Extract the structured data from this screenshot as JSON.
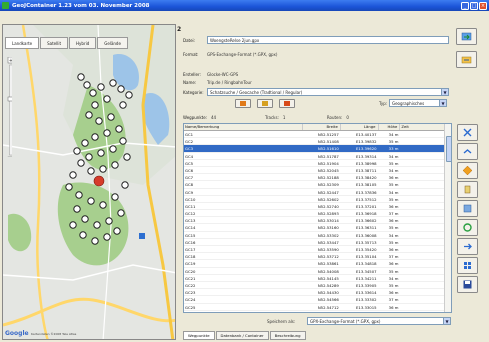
{
  "window": {
    "title": "GeoJContainer 1.23 vom 03. November 2008",
    "buttons": [
      "_",
      "□",
      "×"
    ]
  },
  "map": {
    "tabs": [
      "Landkarte",
      "Satellit",
      "Hybrid",
      "Gelände"
    ],
    "logo": "Google",
    "copyright": "Kartendaten ©2008 Tele Atlas",
    "splitter_label": "2"
  },
  "form": {
    "name_label": "Datei:",
    "name_value": "WoengsteRelse 2jun.gpx",
    "format_label": "Format:",
    "format_value": "GPS-Exchange-Format (*.GPX, gpx)",
    "author_label": "Ersteller:",
    "author_value": "Glocke-WC-GPS",
    "desc_label": "Name:",
    "desc_value": "Trip.de / RingbahnTour",
    "type_label": "Kategorie:",
    "type_value": "Schatzsuche / Geocache (Tradtional / Regular)",
    "icon_label": "Typ:",
    "icon_value": "Geographisches",
    "wp_label": "Wegpunkte:",
    "wp_value": "44",
    "tracks_label": "Tracks:",
    "tracks_value": "1",
    "routes_label": "Routen:",
    "routes_value": "0"
  },
  "table": {
    "columns": [
      "Name/Bemerkung",
      "Breite",
      "Länge",
      "Höhe",
      "Zeit"
    ],
    "rows": [
      [
        "GC1",
        "N52.51257",
        "E13.40137",
        "34 m",
        ""
      ],
      [
        "GC2",
        "N52.51408",
        "E13.39832",
        "35 m",
        ""
      ],
      [
        "GC3",
        "N52.51610",
        "E13.39620",
        "33 m",
        ""
      ],
      [
        "GC4",
        "N52.51787",
        "E13.39314",
        "34 m",
        ""
      ],
      [
        "GC5",
        "N52.51904",
        "E13.38998",
        "35 m",
        ""
      ],
      [
        "GC6",
        "N52.52045",
        "E13.38711",
        "34 m",
        ""
      ],
      [
        "GC7",
        "N52.52188",
        "E13.38420",
        "36 m",
        ""
      ],
      [
        "GC8",
        "N52.52309",
        "E13.38105",
        "35 m",
        ""
      ],
      [
        "GC9",
        "N52.52447",
        "E13.37836",
        "34 m",
        ""
      ],
      [
        "GC10",
        "N52.52602",
        "E13.37512",
        "35 m",
        ""
      ],
      [
        "GC11",
        "N52.52740",
        "E13.37201",
        "36 m",
        ""
      ],
      [
        "GC12",
        "N52.52893",
        "E13.36918",
        "37 m",
        ""
      ],
      [
        "GC13",
        "N52.53014",
        "E13.36602",
        "36 m",
        ""
      ],
      [
        "GC14",
        "N52.53160",
        "E13.36311",
        "35 m",
        ""
      ],
      [
        "GC15",
        "N52.53302",
        "E13.36008",
        "34 m",
        ""
      ],
      [
        "GC16",
        "N52.53447",
        "E13.35713",
        "35 m",
        ""
      ],
      [
        "GC17",
        "N52.53590",
        "E13.35420",
        "36 m",
        ""
      ],
      [
        "GC18",
        "N52.53712",
        "E13.35104",
        "37 m",
        ""
      ],
      [
        "GC19",
        "N52.53861",
        "E13.34818",
        "36 m",
        ""
      ],
      [
        "GC20",
        "N52.54008",
        "E13.34507",
        "35 m",
        ""
      ],
      [
        "GC21",
        "N52.54145",
        "E13.34211",
        "34 m",
        ""
      ],
      [
        "GC22",
        "N52.54289",
        "E13.33905",
        "35 m",
        ""
      ],
      [
        "GC23",
        "N52.54430",
        "E13.33614",
        "36 m",
        ""
      ],
      [
        "GC24",
        "N52.54566",
        "E13.33302",
        "37 m",
        ""
      ],
      [
        "GC25",
        "N52.54712",
        "E13.33015",
        "36 m",
        ""
      ]
    ],
    "selected_index": 2
  },
  "bottom": {
    "label": "Speichern als:",
    "value": "GPX-Exchange-Format (*.GPX, gpx)"
  },
  "status_tabs": [
    "Wegpunkte",
    "Datenbank / Container",
    "Beschreibung"
  ],
  "tools_top": [
    "export-arrow-icon",
    "folder-arrow-icon"
  ],
  "tools": [
    "expand-icon",
    "collapse-icon",
    "diamond-icon",
    "tag-icon",
    "list-icon",
    "refresh-icon",
    "arrow-right-icon",
    "grid-icon",
    "save-icon"
  ]
}
